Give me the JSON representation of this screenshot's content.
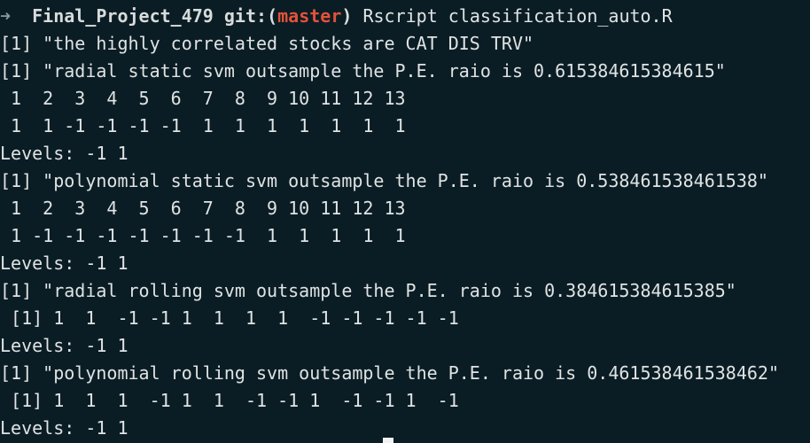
{
  "prompt": {
    "arrow": "➜",
    "directory": "Final_Project_479",
    "git_label": "git:",
    "branch_open": "(",
    "branch": "master",
    "branch_close": ")",
    "command": "Rscript classification_auto.R"
  },
  "output_lines": [
    "[1] \"the highly correlated stocks are CAT DIS TRV\"",
    "[1] \"radial static svm outsample the P.E. raio is 0.615384615384615\"",
    " 1  2  3  4  5  6  7  8  9 10 11 12 13",
    " 1  1 -1 -1 -1 -1  1  1  1  1  1  1  1",
    "Levels: -1 1",
    "[1] \"polynomial static svm outsample the P.E. raio is 0.538461538461538\"",
    " 1  2  3  4  5  6  7  8  9 10 11 12 13",
    " 1 -1 -1 -1 -1 -1 -1 -1  1  1  1  1  1",
    "Levels: -1 1",
    "[1] \"radial rolling svm outsample the P.E. raio is 0.384615384615385\"",
    " [1] 1  1  -1 -1 1  1  1  1  -1 -1 -1 -1 -1",
    "Levels: -1 1",
    "[1] \"polynomial rolling svm outsample the P.E. raio is 0.461538461538462\"",
    " [1] 1  1  1  -1 1  1  -1 -1 1  -1 -1 1  -1",
    "Levels: -1 1"
  ],
  "colors": {
    "background": "#0b1d24",
    "text": "#dfe3e4",
    "branch": "#e3523a",
    "arrow": "#8c9aa0"
  }
}
